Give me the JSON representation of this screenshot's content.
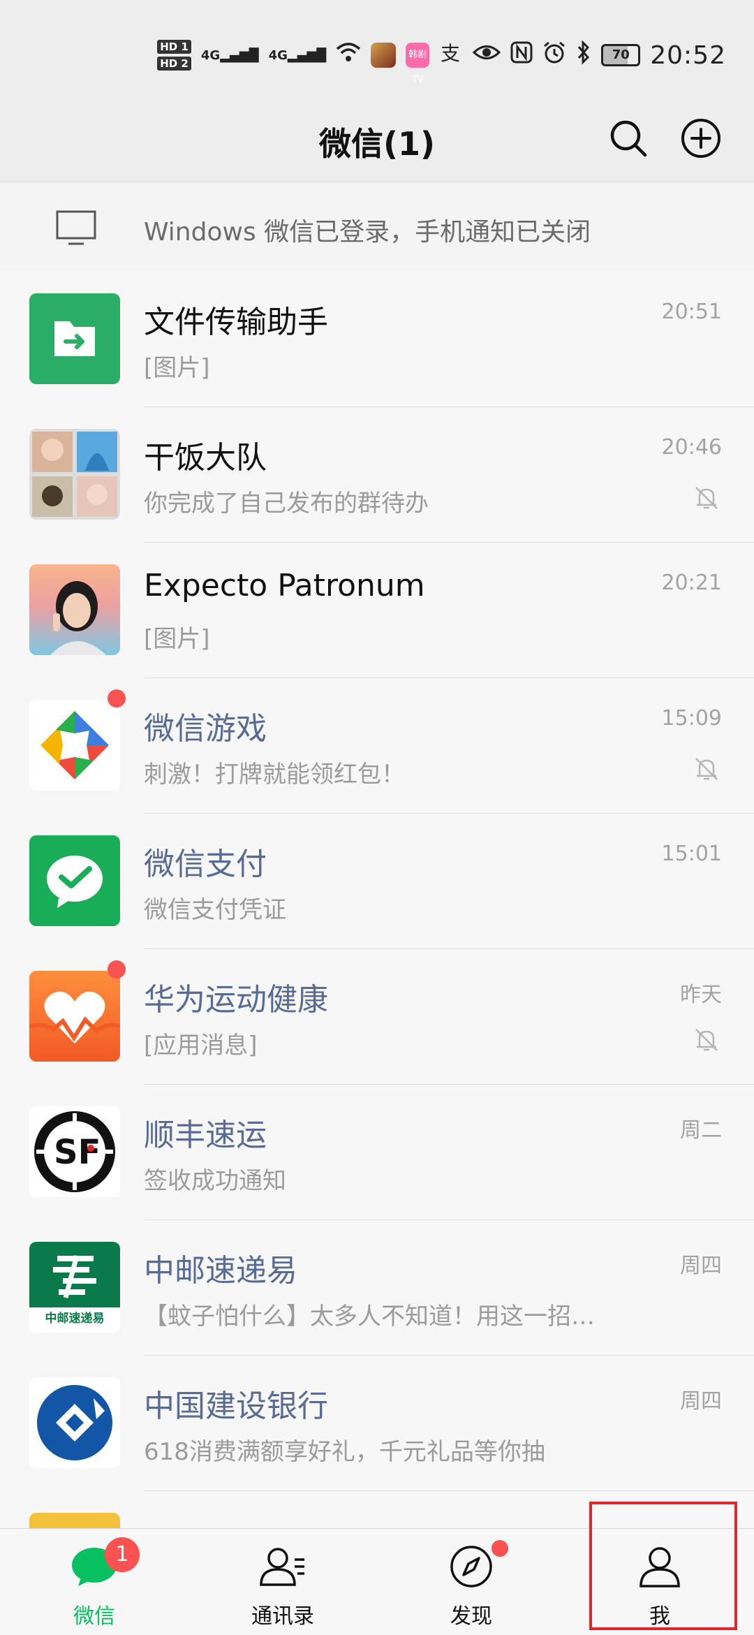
{
  "status_bar": {
    "hd1": "HD 1",
    "hd2": "HD 2",
    "sig1": "4G",
    "sig2": "4G",
    "tv": "韩剧TV",
    "battery": "70",
    "time": "20:52"
  },
  "header": {
    "title": "微信(1)"
  },
  "login_banner": {
    "text": "Windows 微信已登录，手机通知已关闭"
  },
  "chats": [
    {
      "name": "文件传输助手",
      "preview": "[图片]",
      "time": "20:51",
      "muted": false,
      "unread_dot": false,
      "service": false,
      "avatar": "file-transfer-icon"
    },
    {
      "name": "干饭大队",
      "preview": "你完成了自己发布的群待办",
      "time": "20:46",
      "muted": true,
      "unread_dot": false,
      "service": false,
      "avatar": "group-photo"
    },
    {
      "name": "Expecto Patronum",
      "preview": "[图片]",
      "time": "20:21",
      "muted": false,
      "unread_dot": false,
      "service": false,
      "avatar": "person-photo"
    },
    {
      "name": "微信游戏",
      "preview": "刺激！打牌就能领红包！",
      "time": "15:09",
      "muted": true,
      "unread_dot": true,
      "service": true,
      "avatar": "wechat-games-icon"
    },
    {
      "name": "微信支付",
      "preview": "微信支付凭证",
      "time": "15:01",
      "muted": false,
      "unread_dot": false,
      "service": true,
      "avatar": "wechat-pay-icon"
    },
    {
      "name": "华为运动健康",
      "preview": "[应用消息]",
      "time": "昨天",
      "muted": true,
      "unread_dot": true,
      "service": true,
      "avatar": "huawei-health-icon"
    },
    {
      "name": "顺丰速运",
      "preview": "签收成功通知",
      "time": "周二",
      "muted": false,
      "unread_dot": false,
      "service": true,
      "avatar": "sf-express-icon"
    },
    {
      "name": "中邮速递易",
      "preview": "【蚊子怕什么】太多人不知道！用这一招…",
      "time": "周四",
      "muted": false,
      "unread_dot": false,
      "service": true,
      "avatar": "china-post-icon"
    },
    {
      "name": "中国建设银行",
      "preview": "618消费满额享好礼，千元礼品等你抽",
      "time": "周四",
      "muted": false,
      "unread_dot": false,
      "service": true,
      "avatar": "ccb-icon"
    }
  ],
  "avatar_logos": {
    "china_post": "中邮速递易"
  },
  "bottom_nav": {
    "tabs": [
      {
        "label": "微信",
        "badge": "1"
      },
      {
        "label": "通讯录"
      },
      {
        "label": "发现"
      },
      {
        "label": "我"
      }
    ]
  },
  "colors": {
    "wechat_green": "#07c160",
    "service_name": "#576b95",
    "badge_red": "#fa5151",
    "highlight_red": "#e4252c"
  }
}
